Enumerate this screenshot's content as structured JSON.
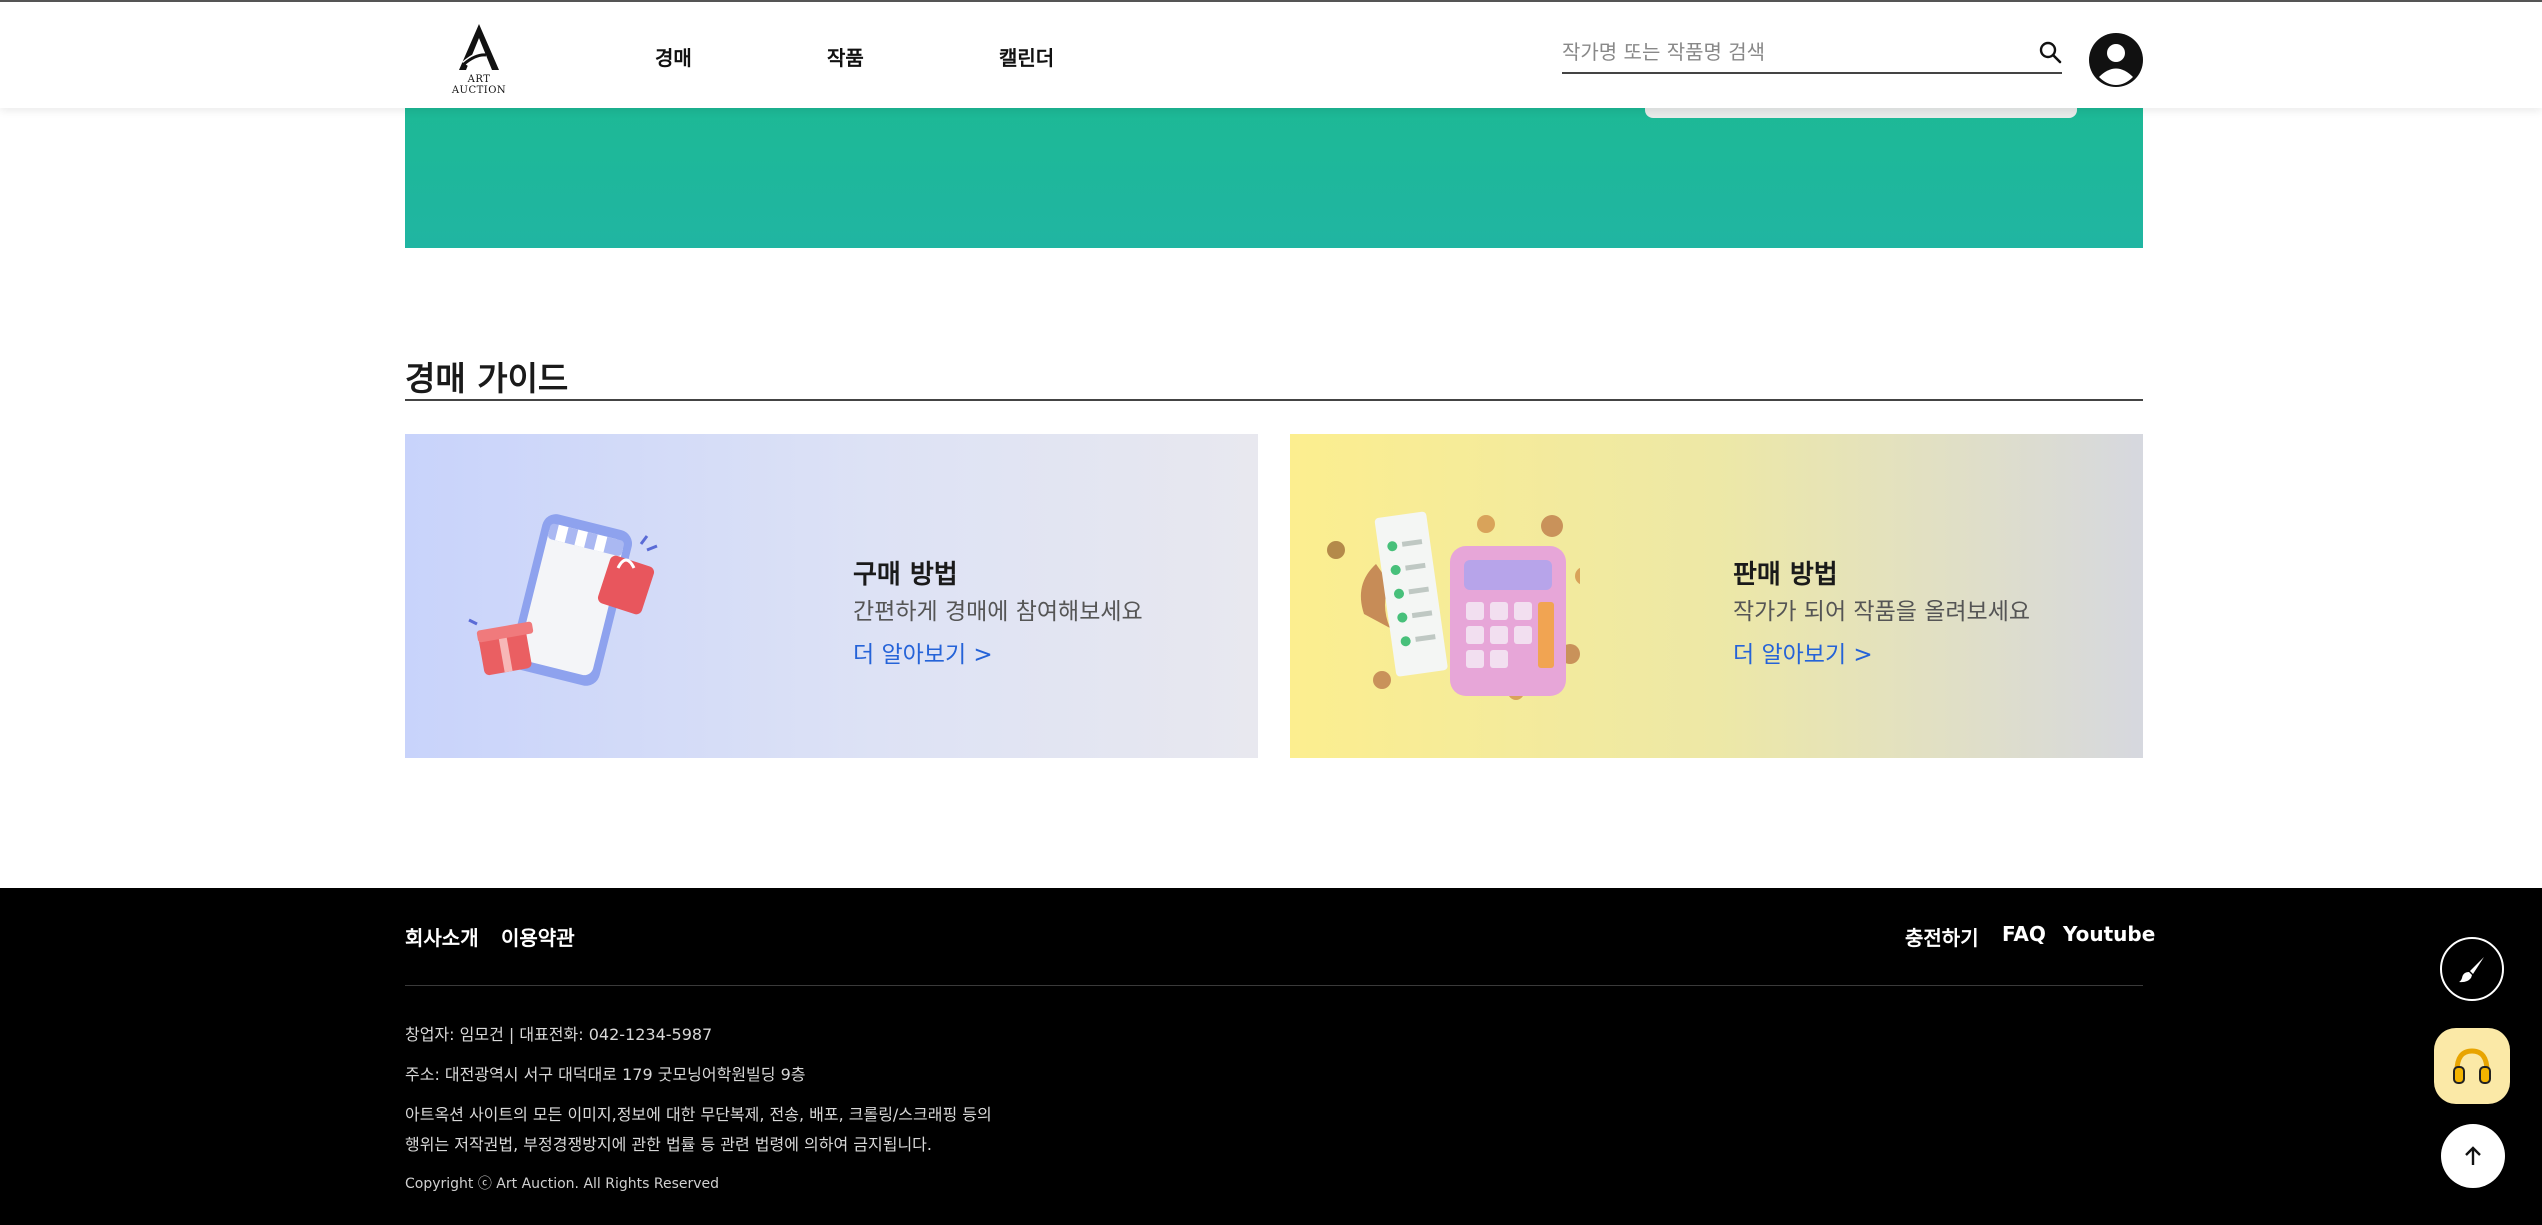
{
  "header": {
    "logo_text": "ART AUCTION",
    "nav": [
      {
        "label": "경매"
      },
      {
        "label": "작품"
      },
      {
        "label": "캘린더"
      }
    ],
    "search": {
      "placeholder": "작가명 또는 작품명 검색",
      "value": ""
    }
  },
  "guide": {
    "title": "경매 가이드",
    "cards": [
      {
        "heading": "구매 방법",
        "desc": "간편하게 경매에 참여해보세요",
        "link": "더 알아보기 >",
        "illustration": "phone-shopping-illustration"
      },
      {
        "heading": "판매 방법",
        "desc": "작가가 되어 작품을 올려보세요",
        "link": "더 알아보기 >",
        "illustration": "calculator-receipt-illustration"
      }
    ]
  },
  "footer": {
    "left_links": [
      "회사소개",
      "이용약관"
    ],
    "right_links": [
      "충전하기",
      "FAQ",
      "Youtube"
    ],
    "info": [
      "창업자: 임모건 | 대표전화: 042-1234-5987",
      "주소: 대전광역시 서구 대덕대로 179 굿모닝어학원빌딩 9층",
      "아트옥션 사이트의 모든 이미지,정보에 대한 무단복제, 전송, 배포, 크롤링/스크래핑 등의",
      "행위는 저작권법, 부정경쟁방지에 관한 법률 등 관련 법령에 의하여 금지됩니다."
    ],
    "copyright": "Copyright ⓒ Art Auction. All Rights Reserved"
  },
  "floating": {
    "brush_icon": "brush-icon",
    "support_icon": "headset-icon",
    "top_icon": "arrow-up-icon"
  },
  "colors": {
    "banner": "#1db996",
    "link": "#2563d8",
    "footer_bg": "#000000",
    "support_bg": "#fbe9a7"
  }
}
